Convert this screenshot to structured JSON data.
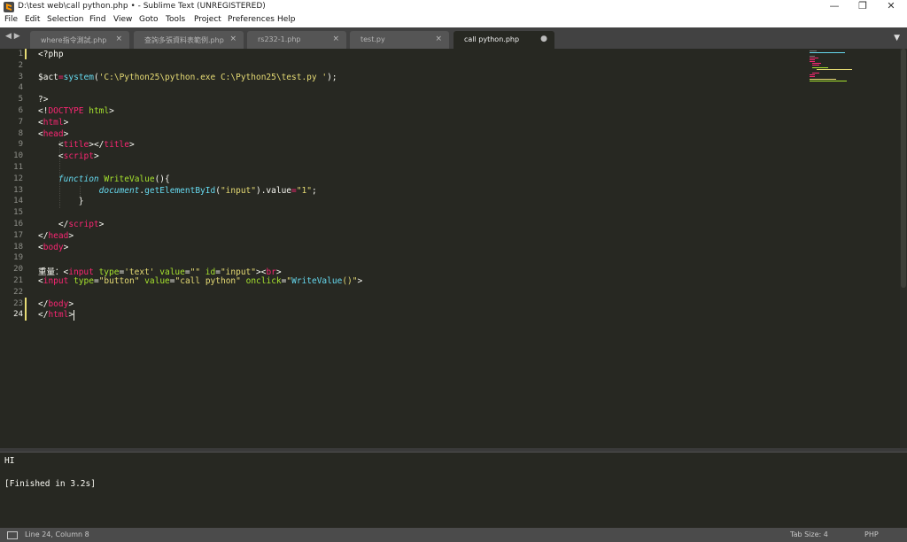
{
  "window": {
    "title": "D:\\test web\\call python.php • - Sublime Text (UNREGISTERED)",
    "minimize": "—",
    "maximize": "❐",
    "close": "✕"
  },
  "menu": [
    "File",
    "Edit",
    "Selection",
    "Find",
    "View",
    "Goto",
    "Tools",
    "Project",
    "Preferences",
    "Help"
  ],
  "tabs": {
    "nav": "◀ ▶",
    "items": [
      {
        "label": "where指令測試.php",
        "close": "×"
      },
      {
        "label": "查詢多張資料表範例.php",
        "close": "×"
      },
      {
        "label": "rs232-1.php",
        "close": "×"
      },
      {
        "label": "test.py",
        "close": "×"
      },
      {
        "label": "call python.php",
        "close": "●"
      }
    ],
    "menu_arrow": "▼"
  },
  "editor": {
    "line_numbers": [
      "1",
      "2",
      "3",
      "4",
      "5",
      "6",
      "7",
      "8",
      "9",
      "10",
      "11",
      "12",
      "13",
      "14",
      "15",
      "16",
      "17",
      "18",
      "19",
      "20",
      "21",
      "22",
      "23",
      "24"
    ],
    "cursor": {
      "line": 24,
      "column": 8
    },
    "lines": [
      [
        {
          "t": "<?php",
          "c": "#f8f8f2"
        }
      ],
      [],
      [
        {
          "t": "$act",
          "c": "#f8f8f2"
        },
        {
          "t": "=",
          "c": "#f92672"
        },
        {
          "t": "system",
          "c": "#66d9ef"
        },
        {
          "t": "(",
          "c": "#f8f8f2"
        },
        {
          "t": "'C:\\Python25\\python.exe C:\\Python25\\test.py '",
          "c": "#e6db74"
        },
        {
          "t": ");",
          "c": "#f8f8f2"
        }
      ],
      [],
      [
        {
          "t": "?>",
          "c": "#f8f8f2"
        }
      ],
      [
        {
          "t": "<!",
          "c": "#f8f8f2"
        },
        {
          "t": "DOCTYPE",
          "c": "#f92672"
        },
        {
          "t": " html",
          "c": "#a6e22e"
        },
        {
          "t": ">",
          "c": "#f8f8f2"
        }
      ],
      [
        {
          "t": "<",
          "c": "#f8f8f2"
        },
        {
          "t": "html",
          "c": "#f92672"
        },
        {
          "t": ">",
          "c": "#f8f8f2"
        }
      ],
      [
        {
          "t": "<",
          "c": "#f8f8f2"
        },
        {
          "t": "head",
          "c": "#f92672"
        },
        {
          "t": ">",
          "c": "#f8f8f2"
        }
      ],
      [
        {
          "t": "    <",
          "c": "#f8f8f2"
        },
        {
          "t": "title",
          "c": "#f92672"
        },
        {
          "t": "></",
          "c": "#f8f8f2"
        },
        {
          "t": "title",
          "c": "#f92672"
        },
        {
          "t": ">",
          "c": "#f8f8f2"
        }
      ],
      [
        {
          "t": "    <",
          "c": "#f8f8f2"
        },
        {
          "t": "script",
          "c": "#f92672"
        },
        {
          "t": ">",
          "c": "#f8f8f2"
        }
      ],
      [],
      [
        {
          "t": "    function",
          "c": "#66d9ef",
          "i": true
        },
        {
          "t": " ",
          "c": "#f8f8f2"
        },
        {
          "t": "WriteValue",
          "c": "#a6e22e"
        },
        {
          "t": "(){",
          "c": "#f8f8f2"
        }
      ],
      [
        {
          "t": "            document",
          "c": "#66d9ef",
          "i": true
        },
        {
          "t": ".",
          "c": "#f8f8f2"
        },
        {
          "t": "getElementById",
          "c": "#66d9ef"
        },
        {
          "t": "(",
          "c": "#f8f8f2"
        },
        {
          "t": "\"input\"",
          "c": "#e6db74"
        },
        {
          "t": ").value",
          "c": "#f8f8f2"
        },
        {
          "t": "=",
          "c": "#f92672"
        },
        {
          "t": "\"1\"",
          "c": "#e6db74"
        },
        {
          "t": ";",
          "c": "#f8f8f2"
        }
      ],
      [
        {
          "t": "        }",
          "c": "#f8f8f2"
        }
      ],
      [],
      [
        {
          "t": "    </",
          "c": "#f8f8f2"
        },
        {
          "t": "script",
          "c": "#f92672"
        },
        {
          "t": ">",
          "c": "#f8f8f2"
        }
      ],
      [
        {
          "t": "</",
          "c": "#f8f8f2"
        },
        {
          "t": "head",
          "c": "#f92672"
        },
        {
          "t": ">",
          "c": "#f8f8f2"
        }
      ],
      [
        {
          "t": "<",
          "c": "#f8f8f2"
        },
        {
          "t": "body",
          "c": "#f92672"
        },
        {
          "t": ">",
          "c": "#f8f8f2"
        }
      ],
      [],
      [
        {
          "t": "重量：",
          "c": "#f8f8f2"
        },
        {
          "t": "<",
          "c": "#f8f8f2"
        },
        {
          "t": "input",
          "c": "#f92672"
        },
        {
          "t": " type",
          "c": "#a6e22e"
        },
        {
          "t": "=",
          "c": "#f8f8f2"
        },
        {
          "t": "'text'",
          "c": "#e6db74"
        },
        {
          "t": " value",
          "c": "#a6e22e"
        },
        {
          "t": "=",
          "c": "#f8f8f2"
        },
        {
          "t": "\"\"",
          "c": "#e6db74"
        },
        {
          "t": " id",
          "c": "#a6e22e"
        },
        {
          "t": "=",
          "c": "#f8f8f2"
        },
        {
          "t": "\"input\"",
          "c": "#e6db74"
        },
        {
          "t": "><",
          "c": "#f8f8f2"
        },
        {
          "t": "br",
          "c": "#f92672"
        },
        {
          "t": ">",
          "c": "#f8f8f2"
        }
      ],
      [
        {
          "t": "<",
          "c": "#f8f8f2"
        },
        {
          "t": "input",
          "c": "#f92672"
        },
        {
          "t": " type",
          "c": "#a6e22e"
        },
        {
          "t": "=",
          "c": "#f8f8f2"
        },
        {
          "t": "\"button\"",
          "c": "#e6db74"
        },
        {
          "t": " value",
          "c": "#a6e22e"
        },
        {
          "t": "=",
          "c": "#f8f8f2"
        },
        {
          "t": "\"call python\"",
          "c": "#e6db74"
        },
        {
          "t": " onclick",
          "c": "#a6e22e"
        },
        {
          "t": "=",
          "c": "#f8f8f2"
        },
        {
          "t": "\"",
          "c": "#e6db74"
        },
        {
          "t": "WriteValue",
          "c": "#66d9ef"
        },
        {
          "t": "()\"",
          "c": "#e6db74"
        },
        {
          "t": ">",
          "c": "#f8f8f2"
        }
      ],
      [],
      [
        {
          "t": "</",
          "c": "#f8f8f2"
        },
        {
          "t": "body",
          "c": "#f92672"
        },
        {
          "t": ">",
          "c": "#f8f8f2"
        }
      ],
      [
        {
          "t": "</",
          "c": "#f8f8f2"
        },
        {
          "t": "html",
          "c": "#f92672"
        },
        {
          "t": ">",
          "c": "#f8f8f2"
        }
      ]
    ]
  },
  "output": {
    "lines": [
      "HI",
      "",
      "[Finished in 3.2s]"
    ]
  },
  "status": {
    "position": "Line 24, Column 8",
    "tab_size": "Tab Size: 4",
    "syntax": "PHP"
  }
}
